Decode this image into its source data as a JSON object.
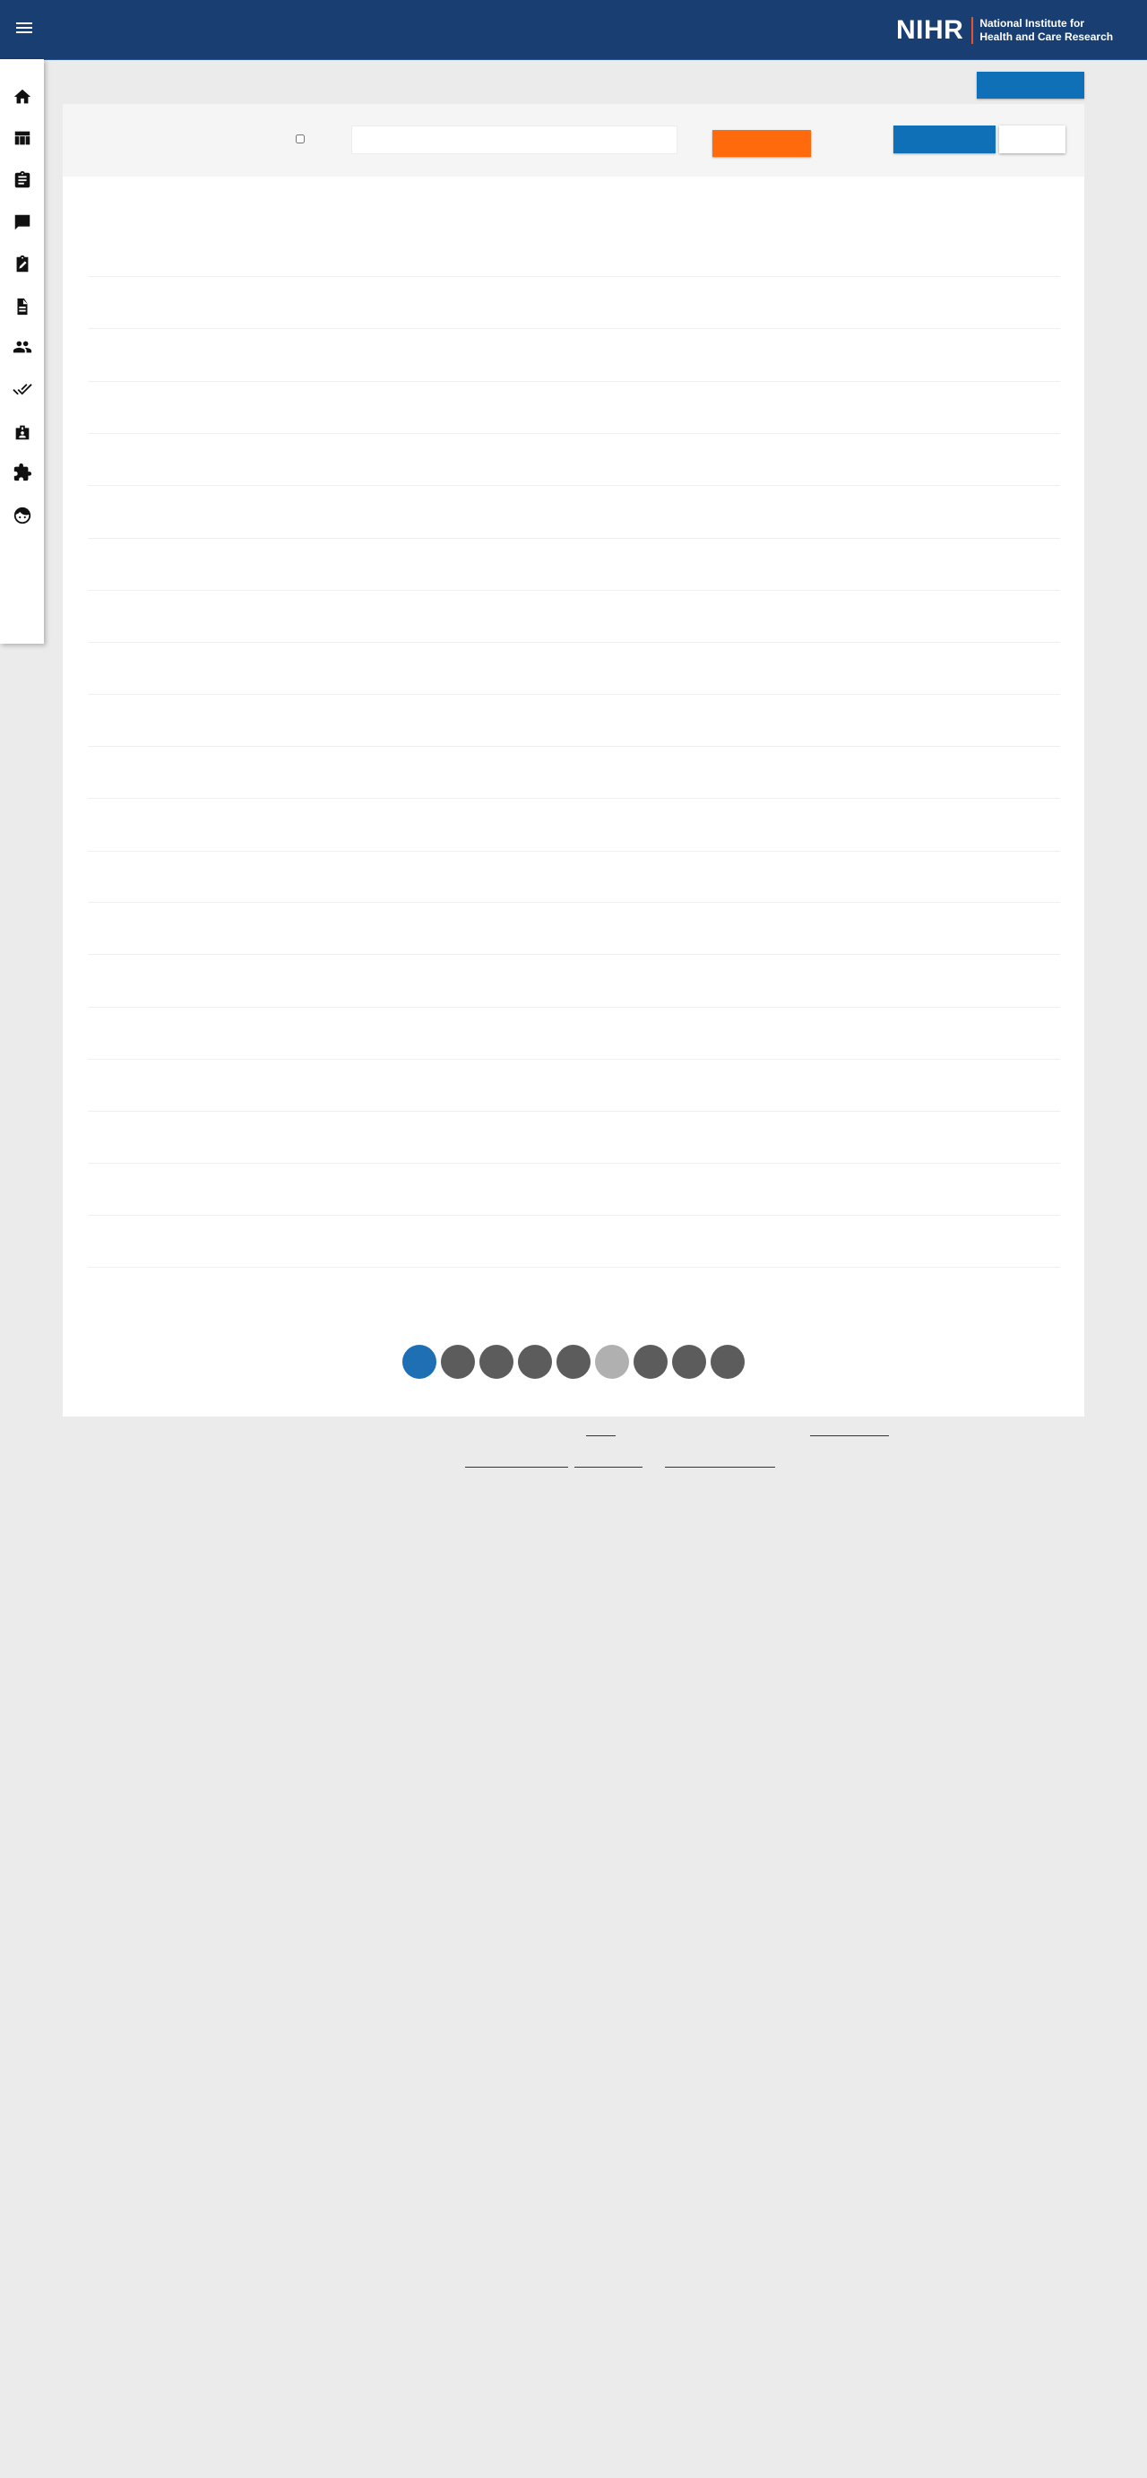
{
  "header": {
    "logo_mark": "NIHR",
    "logo_line1": "National Institute for",
    "logo_line2": "Health and Care Research",
    "background_color": "#193e72",
    "accent_color": "#e8542b"
  },
  "sidebar": {
    "items": [
      {
        "icon": "home-icon"
      },
      {
        "icon": "table-icon"
      },
      {
        "icon": "assignment-icon"
      },
      {
        "icon": "list-alt-icon"
      },
      {
        "icon": "edit-note-icon"
      },
      {
        "icon": "description-icon"
      },
      {
        "icon": "people-icon"
      },
      {
        "icon": "done-all-icon"
      },
      {
        "icon": "badge-icon"
      },
      {
        "icon": "extension-icon"
      },
      {
        "icon": "face-icon"
      }
    ]
  },
  "colors": {
    "primary_button": "#0f70b7",
    "warning_button": "#ff6a0d",
    "page_active": "#1f6fb4",
    "page_default": "#5c5c5c",
    "page_disabled": "#b0b0b0"
  },
  "pagination": {
    "pages": 9,
    "active_page": 1,
    "disabled_page": 6
  }
}
